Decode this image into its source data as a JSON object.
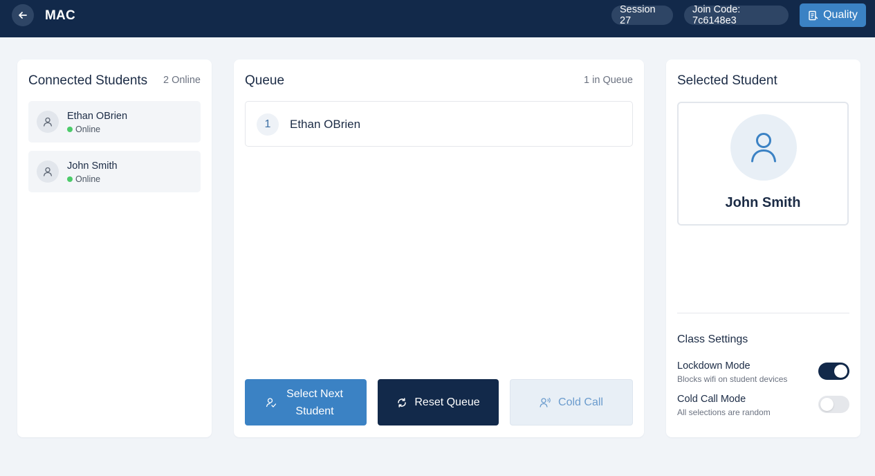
{
  "header": {
    "title": "MAC",
    "session_label": "Session 27",
    "join_code_label": "Join Code: 7c6148e3",
    "quality_label": "Quality"
  },
  "connected": {
    "title": "Connected Students",
    "online_count": "2 Online",
    "students": [
      {
        "name": "Ethan OBrien",
        "status": "Online"
      },
      {
        "name": "John Smith",
        "status": "Online"
      }
    ]
  },
  "queue": {
    "title": "Queue",
    "count": "1 in Queue",
    "items": [
      {
        "position": "1",
        "name": "Ethan OBrien"
      }
    ],
    "buttons": {
      "select_next_line1": "Select Next",
      "select_next_line2": "Student",
      "reset": "Reset Queue",
      "cold_call": "Cold Call"
    }
  },
  "selected": {
    "title": "Selected Student",
    "name": "John Smith"
  },
  "settings": {
    "title": "Class Settings",
    "lockdown_label": "Lockdown Mode",
    "lockdown_desc": "Blocks wifi on student devices",
    "lockdown_on": true,
    "coldcall_label": "Cold Call Mode",
    "coldcall_desc": "All selections are random",
    "coldcall_on": false
  },
  "colors": {
    "header_bg": "#12294a",
    "accent": "#3b82c4",
    "online": "#4ccb6a"
  }
}
